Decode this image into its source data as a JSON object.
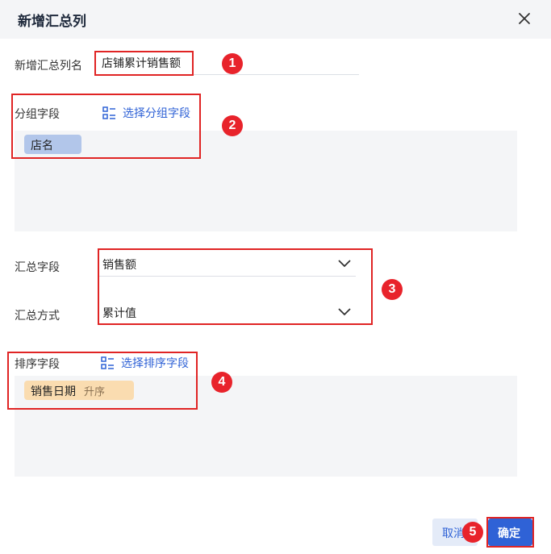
{
  "dialog": {
    "title": "新增汇总列",
    "close_icon": "close-icon"
  },
  "summary_name": {
    "label": "新增汇总列名",
    "value": "店铺累计销售额"
  },
  "group_fields": {
    "label": "分组字段",
    "select_link": "选择分组字段",
    "chips": [
      "店名"
    ]
  },
  "summary_field": {
    "label": "汇总字段",
    "value": "销售额"
  },
  "summary_method": {
    "label": "汇总方式",
    "value": "累计值"
  },
  "sort_fields": {
    "label": "排序字段",
    "select_link": "选择排序字段",
    "chip": {
      "field": "销售日期",
      "order": "升序"
    }
  },
  "buttons": {
    "cancel": "取消",
    "ok": "确定"
  },
  "annotations": [
    "1",
    "2",
    "3",
    "4",
    "5"
  ],
  "colors": {
    "accent": "#2f62d6",
    "annotation_red": "#e02424",
    "group_chip": "#b2c6ea",
    "sort_chip": "#fadcb0"
  }
}
